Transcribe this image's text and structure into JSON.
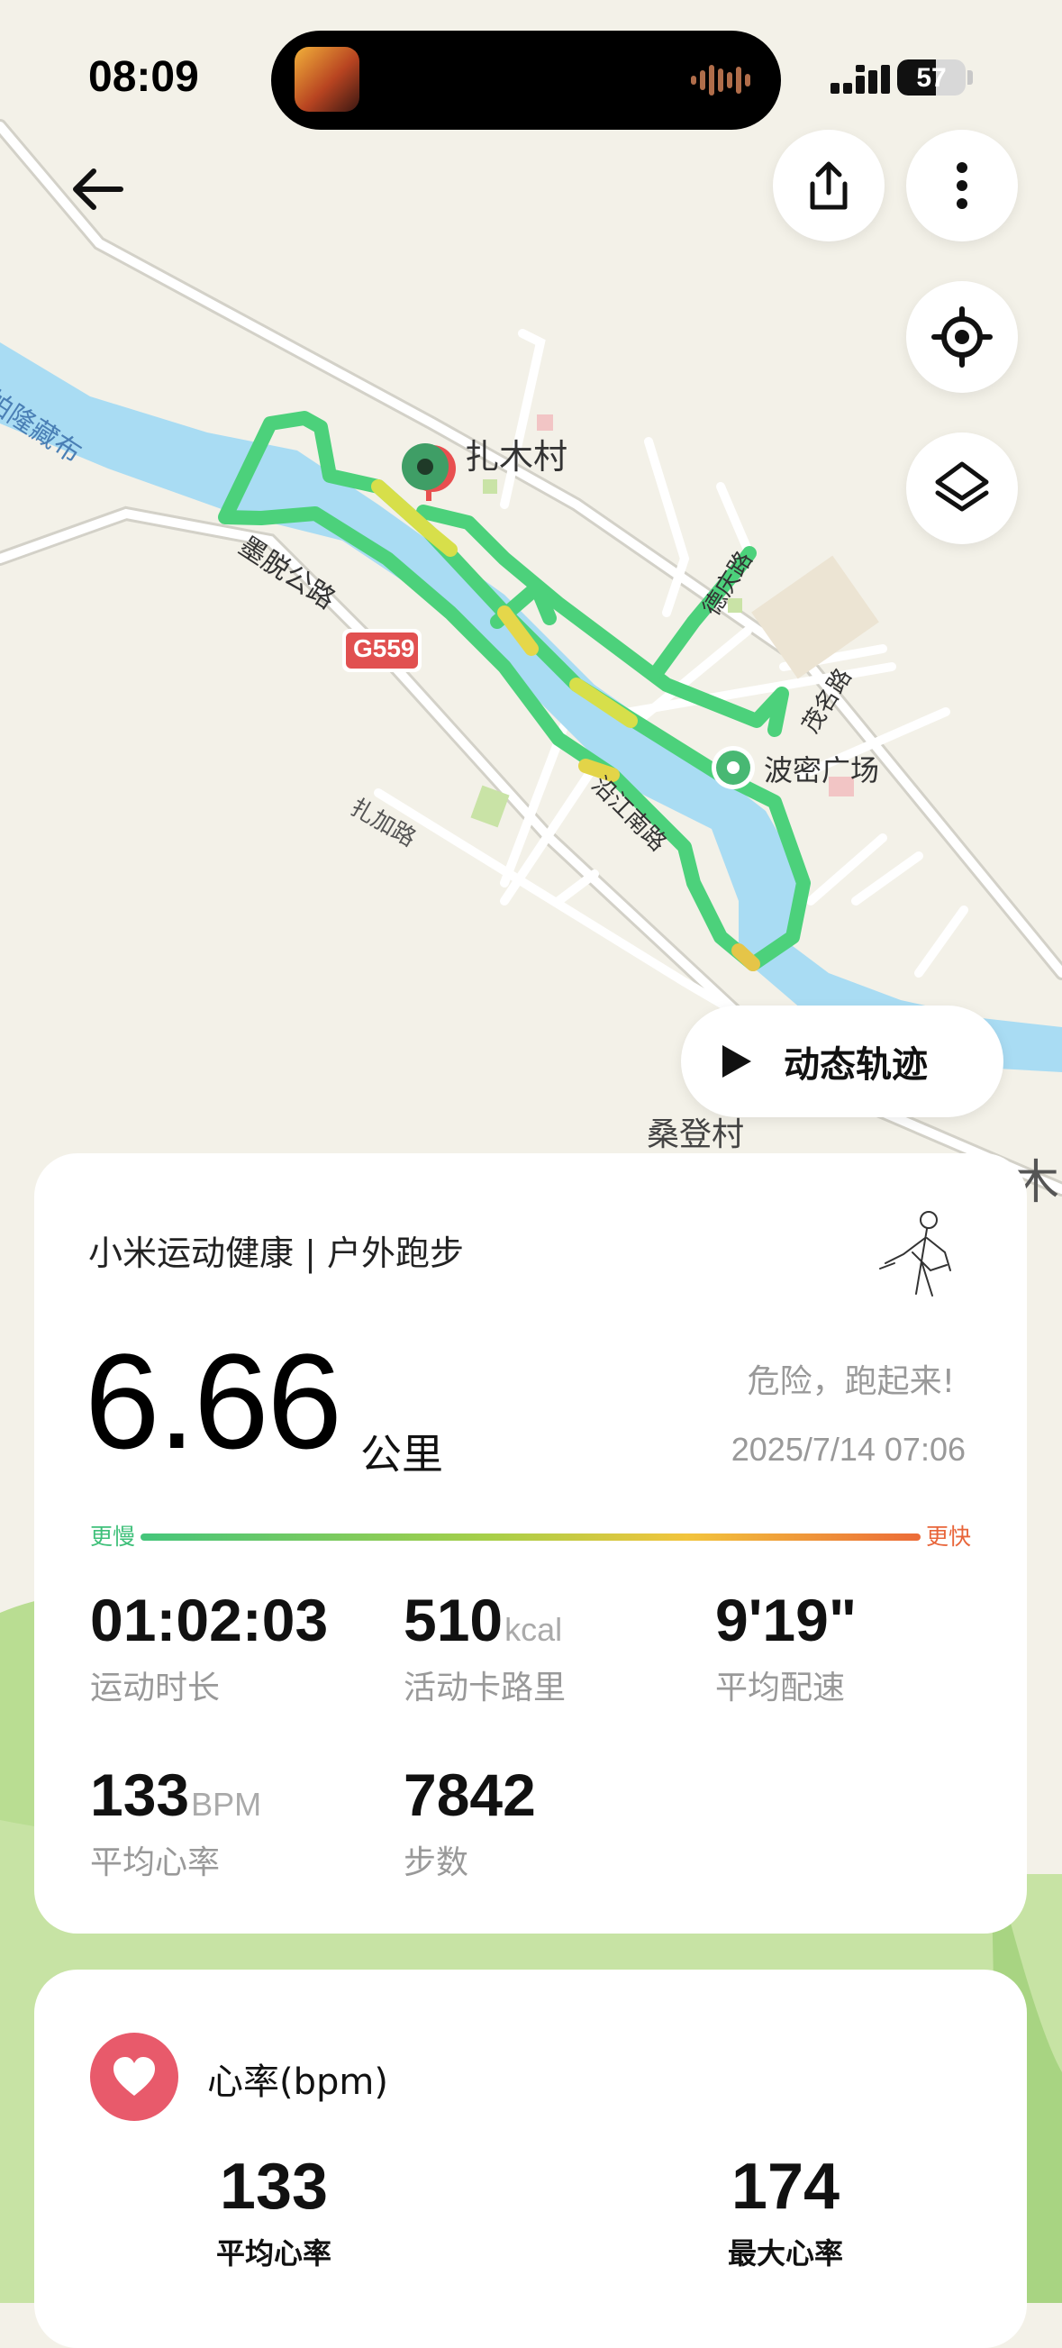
{
  "status_bar": {
    "time": "08:09",
    "battery": "57",
    "battery_level": 0.57
  },
  "map": {
    "labels": {
      "village": "扎木村",
      "river": "帕隆藏布",
      "road_mota": "墨脱公路",
      "highway": "G559",
      "road_deqing": "德庆路",
      "road_maoming": "茂名路",
      "plaza": "波密广场",
      "road_yanjiang": "沿江南路",
      "road_zhajia": "扎加路",
      "sangdeng": "桑登村",
      "edge_char": "木"
    },
    "dynamic_track_label": "动态轨迹",
    "colors": {
      "route": "#4cd17b",
      "river": "#a9dcf3",
      "land": "#f3f1e8",
      "pin": "#3f9e66"
    }
  },
  "workout": {
    "source": "小米运动健康 | 户外跑步",
    "distance": "6.66",
    "distance_unit": "公里",
    "slogan": "危险，跑起来!",
    "datetime": "2025/7/14 07:06",
    "scale": {
      "slow": "更慢",
      "fast": "更快"
    },
    "stats": {
      "duration": {
        "value": "01:02:03",
        "label": "运动时长"
      },
      "calories": {
        "value": "510",
        "unit": "kcal",
        "label": "活动卡路里"
      },
      "pace": {
        "value": "9'19\"",
        "label": "平均配速"
      },
      "heart_rate": {
        "value": "133",
        "unit": "BPM",
        "label": "平均心率"
      },
      "steps": {
        "value": "7842",
        "label": "步数"
      }
    }
  },
  "heart_card": {
    "title": "心率(bpm)",
    "avg": {
      "value": "133",
      "label": "平均心率"
    },
    "max": {
      "value": "174",
      "label": "最大心率"
    }
  }
}
